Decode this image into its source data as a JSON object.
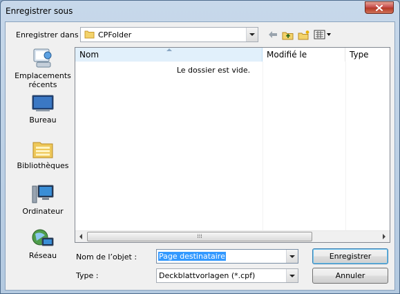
{
  "window": {
    "title": "Enregistrer sous"
  },
  "location": {
    "label": "Enregistrer dans :",
    "value": "CPFolder"
  },
  "sidebar": {
    "items": [
      {
        "label": "Emplacements récents",
        "icon": "recent-places-icon"
      },
      {
        "label": "Bureau",
        "icon": "desktop-icon"
      },
      {
        "label": "Bibliothèques",
        "icon": "libraries-icon"
      },
      {
        "label": "Ordinateur",
        "icon": "computer-icon"
      },
      {
        "label": "Réseau",
        "icon": "network-icon"
      }
    ]
  },
  "file_list": {
    "columns": [
      "Nom",
      "Modifié le",
      "Type"
    ],
    "empty_message": "Le dossier est vide."
  },
  "fields": {
    "filename_label": "Nom de l’objet :",
    "filename_value": "Page destinataire",
    "type_label": "Type :",
    "type_value": "Deckblattvorlagen (*.cpf)"
  },
  "buttons": {
    "save": "Enregistrer",
    "cancel": "Annuler"
  },
  "colors": {
    "selection": "#3399ff",
    "close": "#c75050"
  }
}
